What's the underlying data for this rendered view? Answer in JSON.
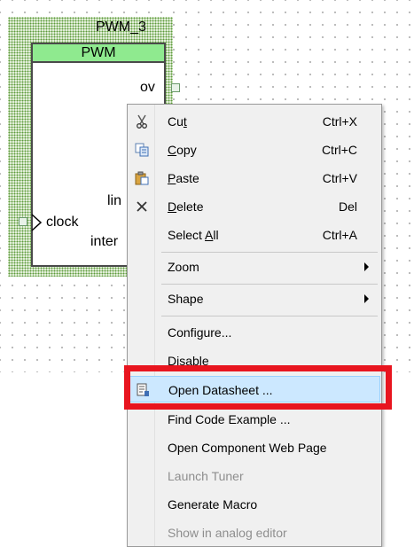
{
  "component": {
    "instance_name": "PWM_3",
    "header": "PWM",
    "pins": {
      "ov": "ov",
      "lin": "lin",
      "clock": "clock",
      "inter": "inter"
    }
  },
  "menu": {
    "cut": {
      "label": "Cut",
      "mnemonic_prefix": "Cu",
      "mnemonic": "t",
      "shortcut": "Ctrl+X",
      "icon": "scissors-icon"
    },
    "copy": {
      "label": "Copy",
      "mnemonic": "C",
      "rest": "opy",
      "shortcut": "Ctrl+C",
      "icon": "copy-icon"
    },
    "paste": {
      "label": "Paste",
      "mnemonic": "P",
      "rest": "aste",
      "shortcut": "Ctrl+V",
      "icon": "paste-icon"
    },
    "delete": {
      "label": "Delete",
      "mnemonic": "D",
      "rest": "elete",
      "shortcut": "Del",
      "icon": "delete-x-icon"
    },
    "select_all": {
      "label": "Select All",
      "prefix": "Select ",
      "mnemonic": "A",
      "rest": "ll",
      "shortcut": "Ctrl+A"
    },
    "zoom": {
      "label": "Zoom"
    },
    "shape": {
      "label": "Shape"
    },
    "configure": {
      "label": "Configure...",
      "prefix": "Confi",
      "mnemonic": "g",
      "rest": "ure..."
    },
    "disable": {
      "label": "Disable"
    },
    "open_datasheet": {
      "label": "Open Datasheet ...",
      "icon": "datasheet-icon"
    },
    "find_code_example": {
      "label": "Find Code Example ..."
    },
    "open_component_web_page": {
      "label": "Open Component Web Page"
    },
    "launch_tuner": {
      "label": "Launch Tuner"
    },
    "generate_macro": {
      "label": "Generate Macro"
    },
    "show_in_analog_editor": {
      "label": "Show in analog editor"
    }
  },
  "colors": {
    "highlight_fill": "#cce8ff",
    "highlight_border": "#99d1ff",
    "annotation_red": "#e8151f",
    "component_header": "#8fea8f"
  }
}
